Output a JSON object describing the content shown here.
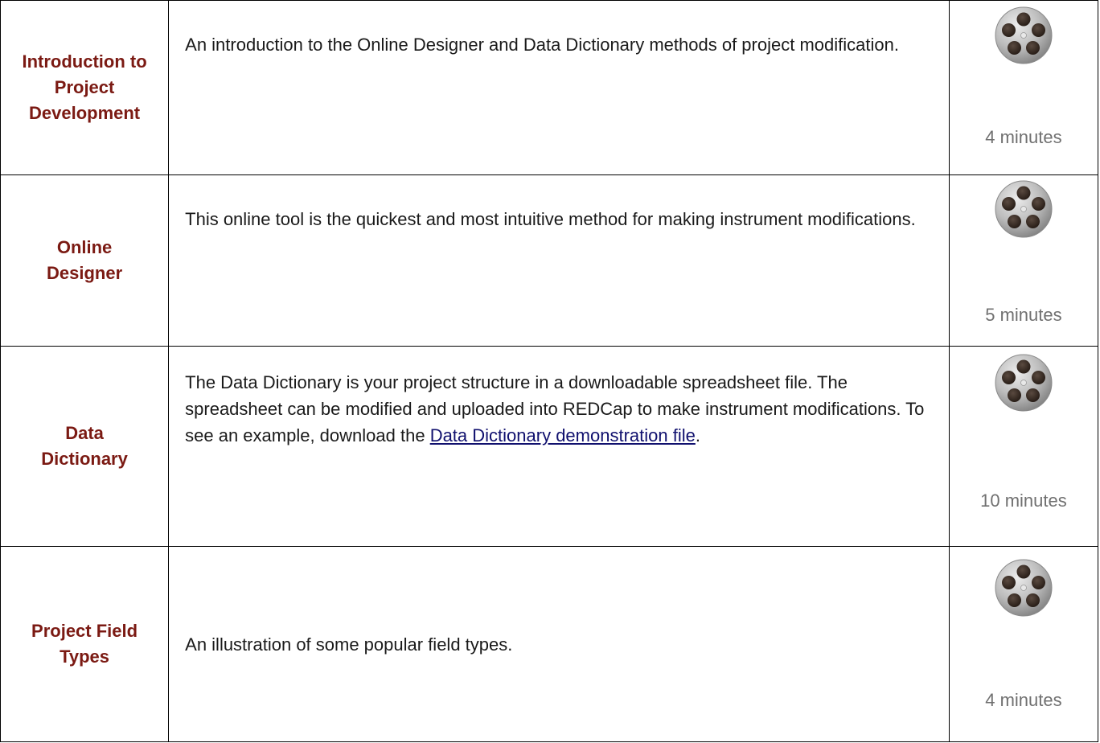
{
  "videos": [
    {
      "title": "Introduction to Project Development",
      "description": "An introduction to the Online Designer and Data Dictionary methods of project modification.",
      "duration": "4 minutes",
      "icon": "film-reel-icon"
    },
    {
      "title": "Online Designer",
      "description": "This online tool is the quickest and most intuitive method for making instrument modifications.",
      "duration": "5 minutes",
      "icon": "film-reel-icon"
    },
    {
      "title": "Data Dictionary",
      "description_before_link": "The Data Dictionary is your project structure in a downloadable spreadsheet file. The spreadsheet can be modified and uploaded into REDCap to make instrument modifications. To see an example, download the ",
      "link_text": "Data Dictionary demonstration file",
      "description_after_link": ".",
      "duration": "10 minutes",
      "icon": "film-reel-icon"
    },
    {
      "title": "Project Field Types",
      "description": "An illustration of some popular field types.",
      "duration": "4 minutes",
      "icon": "film-reel-icon"
    }
  ],
  "colors": {
    "title": "#7b1a13",
    "link": "#10106e",
    "duration": "#707070",
    "border": "#000000"
  }
}
